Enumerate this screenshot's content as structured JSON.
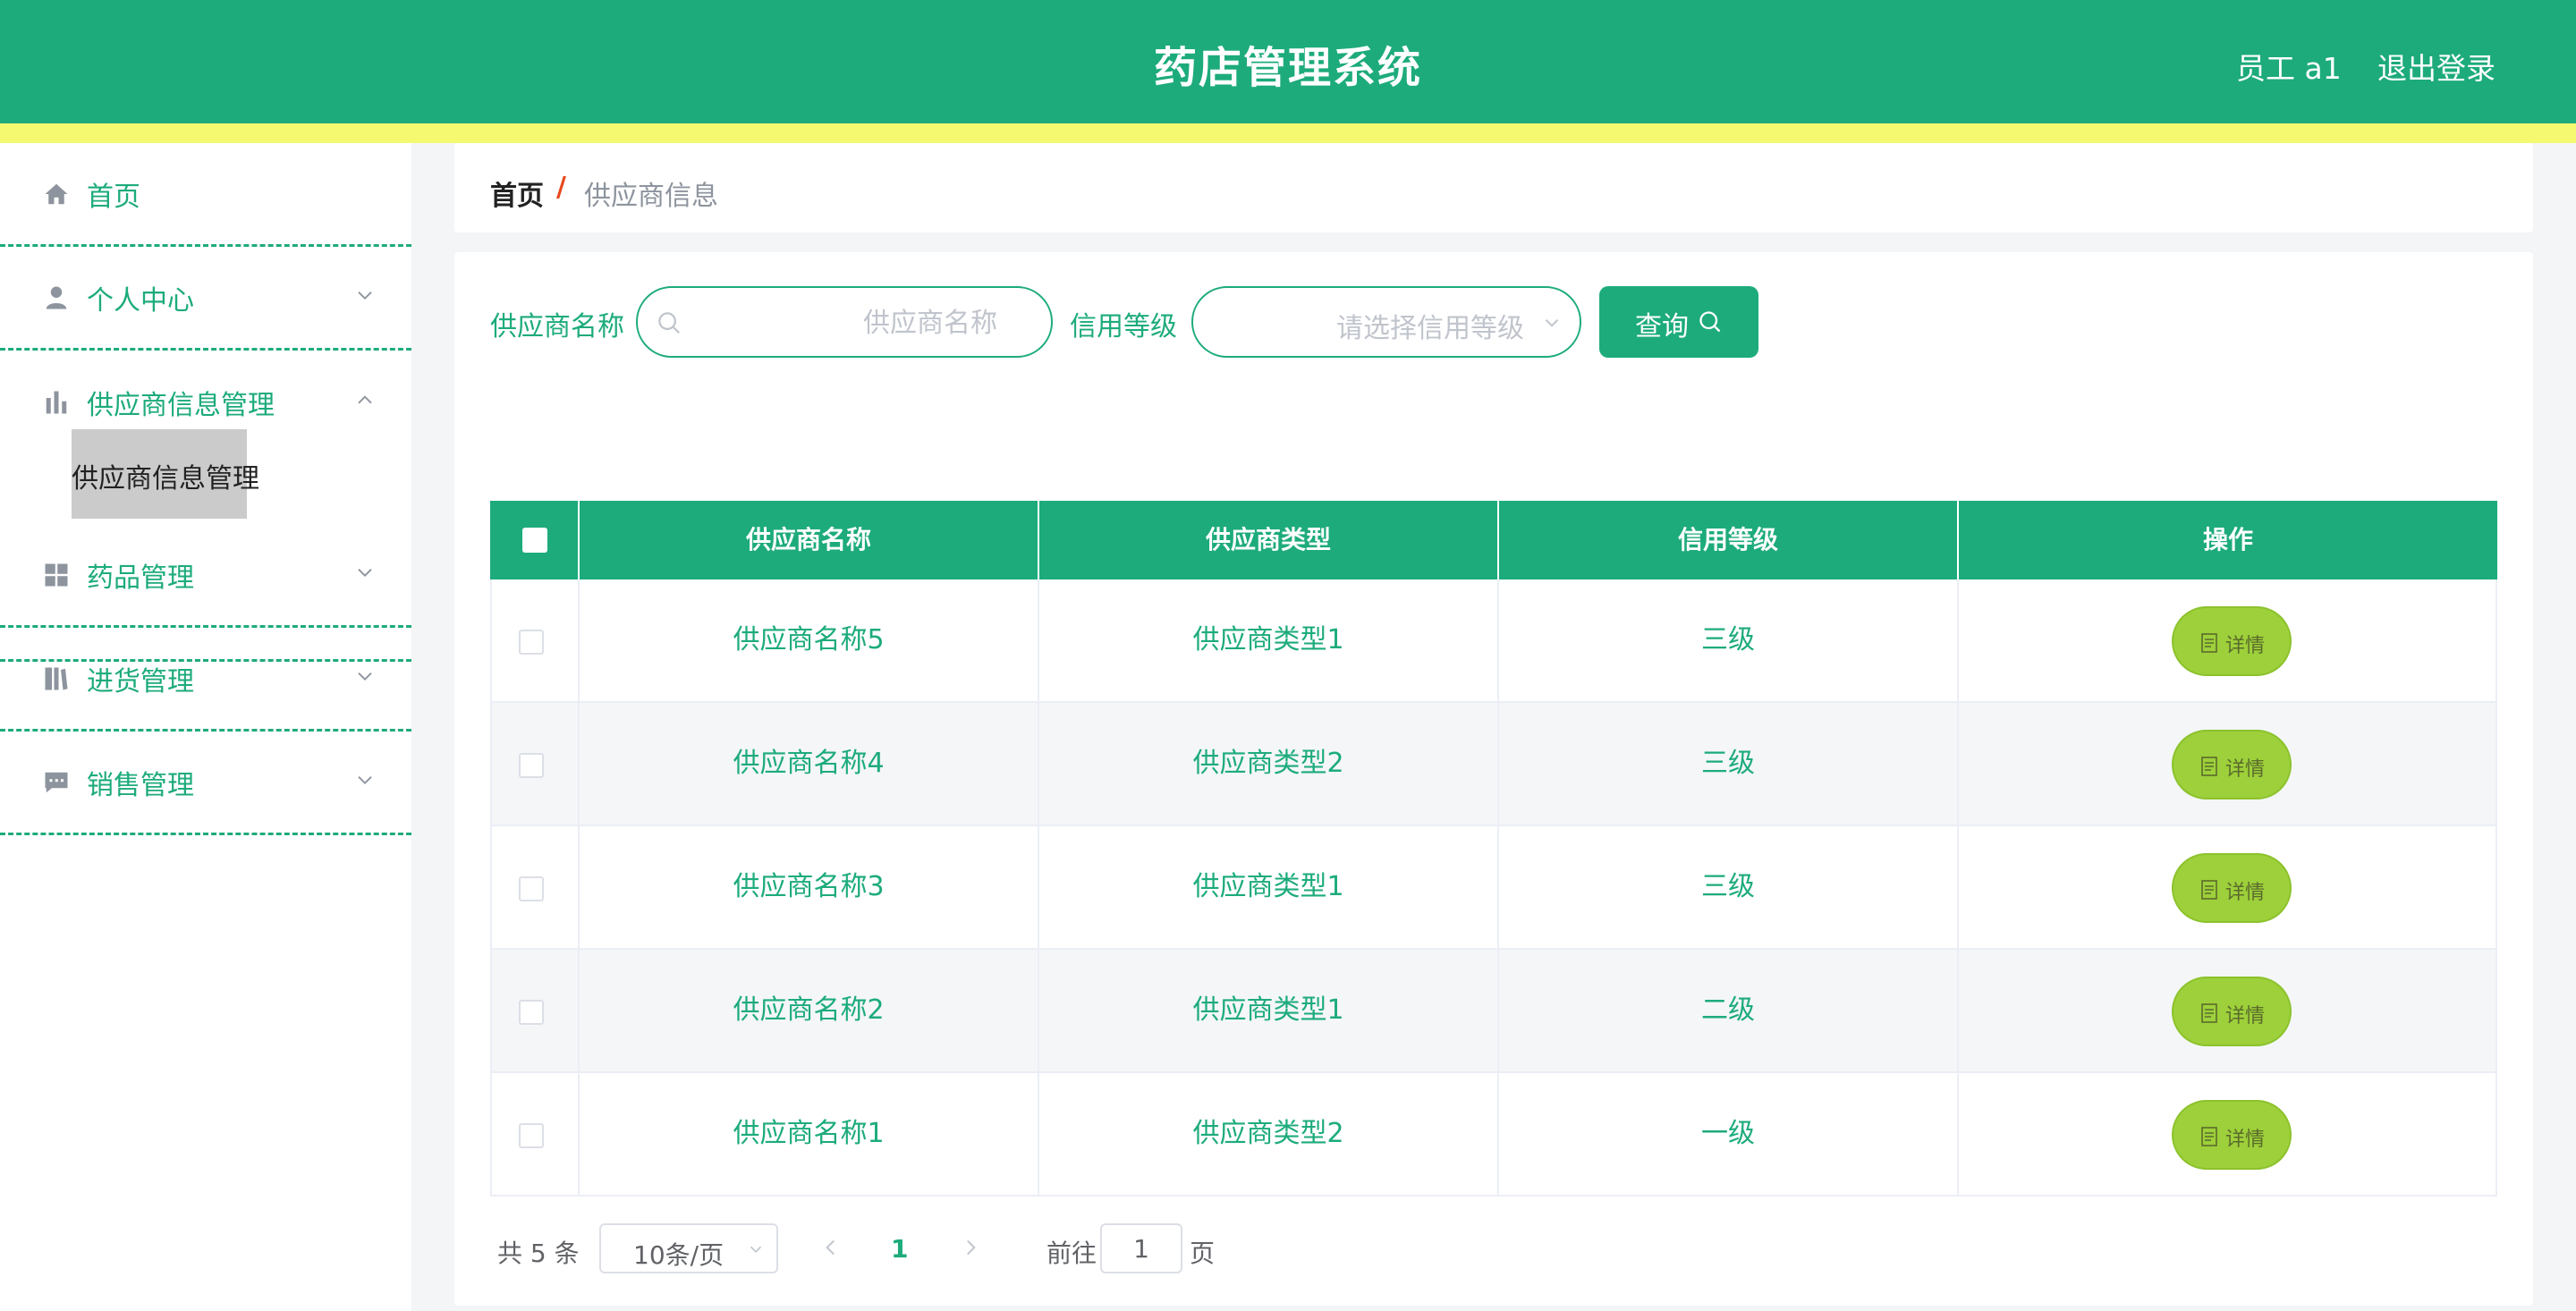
{
  "header": {
    "title": "药店管理系统",
    "user_label": "员工 a1",
    "logout_label": "退出登录"
  },
  "sidebar": {
    "items": [
      {
        "label": "首页",
        "icon": "home-icon"
      },
      {
        "label": "个人中心",
        "icon": "user-icon",
        "expanded": false
      },
      {
        "label": "供应商信息管理",
        "icon": "bar-chart-icon",
        "expanded": true
      },
      {
        "label": "药品管理",
        "icon": "grid-icon",
        "expanded": false
      },
      {
        "label": "进货管理",
        "icon": "book-icon",
        "expanded": false
      },
      {
        "label": "销售管理",
        "icon": "message-icon",
        "expanded": false
      }
    ],
    "submenu": {
      "label": "供应商信息管理"
    }
  },
  "breadcrumb": {
    "home": "首页",
    "separator": "/",
    "current": "供应商信息"
  },
  "filters": {
    "name_label": "供应商名称",
    "name_placeholder": "供应商名称",
    "credit_label": "信用等级",
    "credit_placeholder": "请选择信用等级",
    "query_label": "查询"
  },
  "table": {
    "columns": [
      "供应商名称",
      "供应商类型",
      "信用等级",
      "操作"
    ],
    "detail_label": "详情",
    "rows": [
      {
        "name": "供应商名称5",
        "type": "供应商类型1",
        "credit": "三级"
      },
      {
        "name": "供应商名称4",
        "type": "供应商类型2",
        "credit": "三级"
      },
      {
        "name": "供应商名称3",
        "type": "供应商类型1",
        "credit": "三级"
      },
      {
        "name": "供应商名称2",
        "type": "供应商类型1",
        "credit": "二级"
      },
      {
        "name": "供应商名称1",
        "type": "供应商类型2",
        "credit": "一级"
      }
    ]
  },
  "pagination": {
    "total": "共 5 条",
    "page_size": "10条/页",
    "current_page": "1",
    "goto_label": "前往",
    "goto_value": "1",
    "page_unit": "页"
  },
  "colors": {
    "primary": "#1dab7b",
    "header_strip": "#f4f970",
    "detail_button": "#9dd03a",
    "breadcrumb_separator": "#e8491d"
  }
}
